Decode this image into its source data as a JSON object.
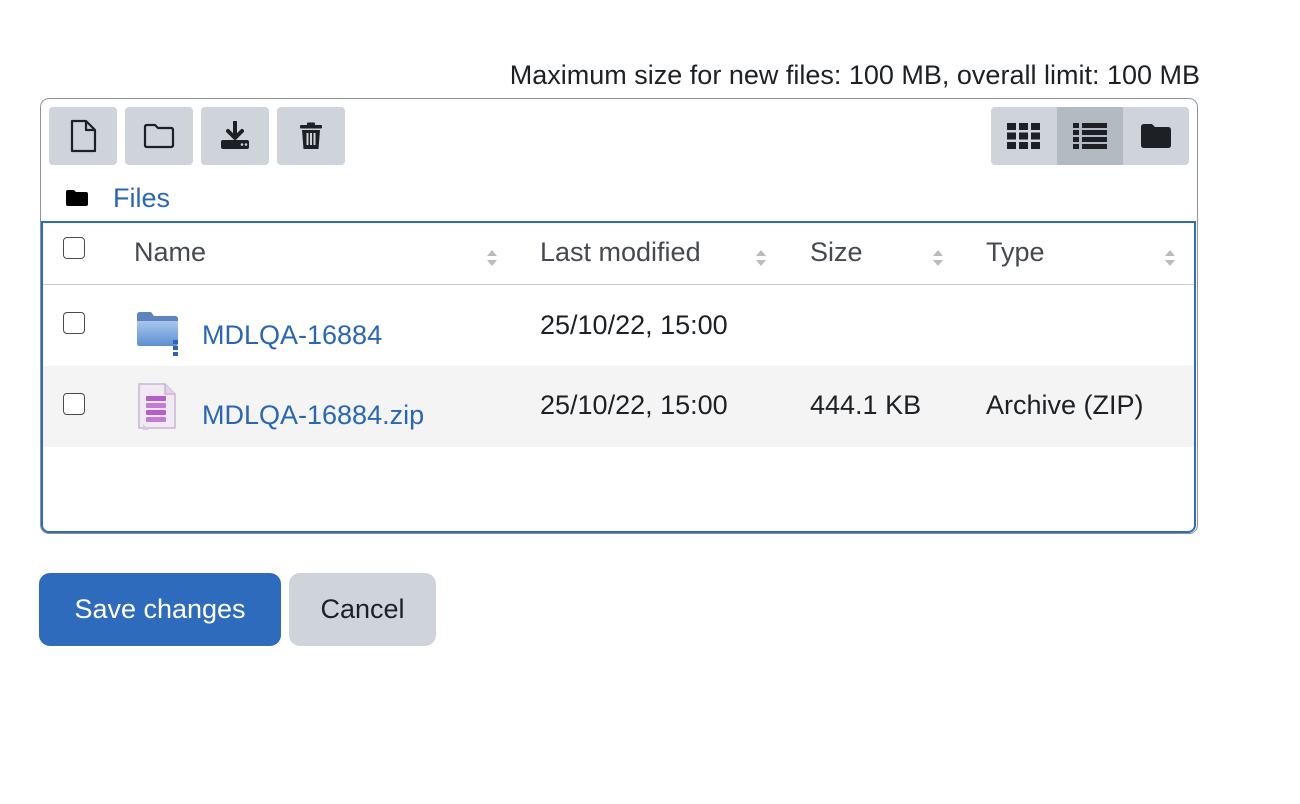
{
  "limit_text": "Maximum size for new files: 100 MB, overall limit: 100 MB",
  "toolbar": {
    "buttons": [
      {
        "name": "add-file",
        "icon": "file-icon"
      },
      {
        "name": "create-folder",
        "icon": "folder-icon"
      },
      {
        "name": "download",
        "icon": "download-icon"
      },
      {
        "name": "delete",
        "icon": "trash-icon"
      }
    ],
    "views": [
      {
        "name": "icons-view",
        "icon": "grid-icon",
        "active": false
      },
      {
        "name": "list-view",
        "icon": "list-icon",
        "active": true
      },
      {
        "name": "tree-view",
        "icon": "folder-filled-icon",
        "active": false
      }
    ]
  },
  "breadcrumb": {
    "label": "Files"
  },
  "table": {
    "columns": [
      "Name",
      "Last modified",
      "Size",
      "Type"
    ],
    "rows": [
      {
        "name": "MDLQA-16884",
        "icon": "folder-icon",
        "modified": "25/10/22, 15:00",
        "size": "",
        "type": ""
      },
      {
        "name": "MDLQA-16884.zip",
        "icon": "archive-icon",
        "modified": "25/10/22, 15:00",
        "size": "444.1 KB",
        "type": "Archive (ZIP)"
      }
    ]
  },
  "actions": {
    "save_label": "Save changes",
    "cancel_label": "Cancel"
  },
  "colors": {
    "primary": "#2f6bbd",
    "secondary": "#ced4da",
    "link": "#2b66b3"
  }
}
